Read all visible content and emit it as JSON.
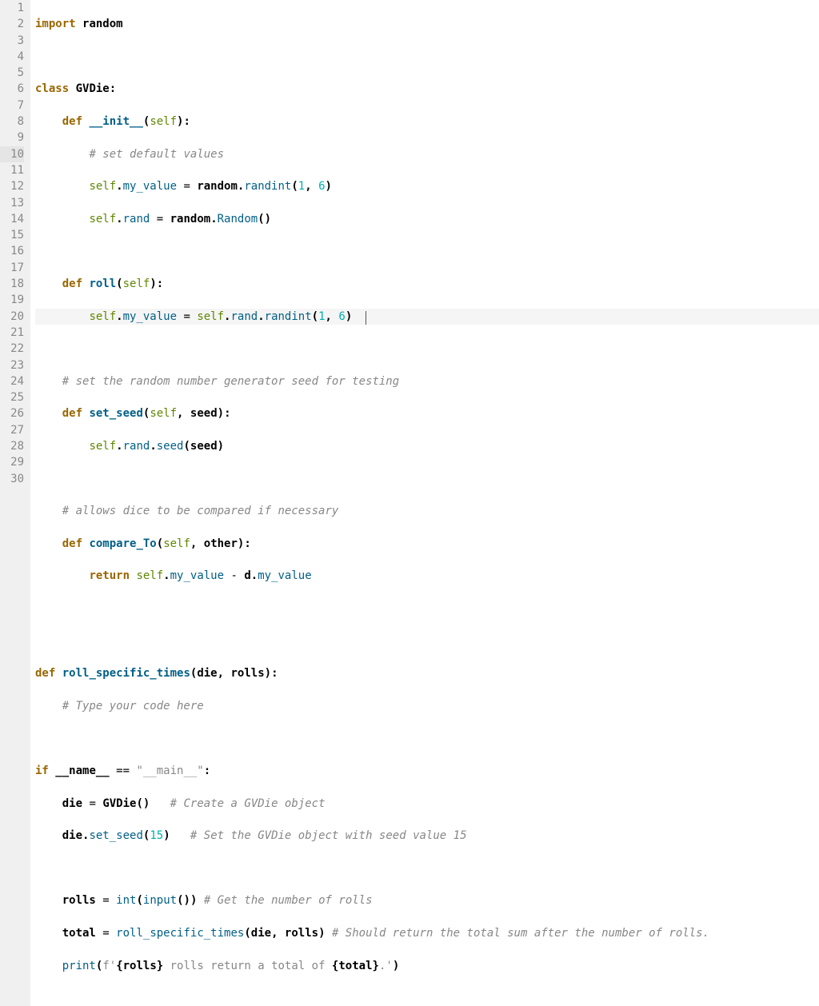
{
  "line_numbers": [
    "1",
    "2",
    "3",
    "4",
    "5",
    "6",
    "7",
    "8",
    "9",
    "10",
    "11",
    "12",
    "13",
    "14",
    "15",
    "16",
    "17",
    "18",
    "19",
    "20",
    "21",
    "22",
    "23",
    "24",
    "25",
    "26",
    "27",
    "28",
    "29",
    "30"
  ],
  "highlighted_line": 10,
  "code": {
    "l1": {
      "kw_import": "import",
      "mod": "random"
    },
    "l3": {
      "kw_class": "class",
      "name": "GVDie",
      "colon": ":"
    },
    "l4": {
      "kw_def": "def",
      "fn": "__init__",
      "lp": "(",
      "self": "self",
      "rp": ")",
      "colon": ":"
    },
    "l5": {
      "comment": "# set default values"
    },
    "l6": {
      "self1": "self",
      "attr1": "my_value",
      "eq": " = ",
      "mod": "random",
      "fn": "randint",
      "lp": "(",
      "n1": "1",
      "comma": ", ",
      "n2": "6",
      "rp": ")"
    },
    "l7": {
      "self1": "self",
      "attr1": "rand",
      "eq": " = ",
      "mod": "random",
      "fn": "Random",
      "lp": "(",
      "rp": ")"
    },
    "l9": {
      "kw_def": "def",
      "fn": "roll",
      "lp": "(",
      "self": "self",
      "rp": ")",
      "colon": ":"
    },
    "l10": {
      "self1": "self",
      "attr1": "my_value",
      "eq": " = ",
      "self2": "self",
      "attr2": "rand",
      "fn": "randint",
      "lp": "(",
      "n1": "1",
      "comma": ", ",
      "n2": "6",
      "rp": ")"
    },
    "l12": {
      "comment": "# set the random number generator seed for testing"
    },
    "l13": {
      "kw_def": "def",
      "fn": "set_seed",
      "lp": "(",
      "self": "self",
      "comma": ", ",
      "arg": "seed",
      "rp": ")",
      "colon": ":"
    },
    "l14": {
      "self1": "self",
      "attr1": "rand",
      "fn": "seed",
      "lp": "(",
      "arg": "seed",
      "rp": ")"
    },
    "l16": {
      "comment": "# allows dice to be compared if necessary"
    },
    "l17": {
      "kw_def": "def",
      "fn": "compare_To",
      "lp": "(",
      "self": "self",
      "comma": ", ",
      "arg": "other",
      "rp": ")",
      "colon": ":"
    },
    "l18": {
      "kw_return": "return",
      "self1": "self",
      "attr1": "my_value",
      "minus": " - ",
      "d": "d",
      "attr2": "my_value"
    },
    "l21": {
      "kw_def": "def",
      "fn": "roll_specific_times",
      "lp": "(",
      "a1": "die",
      "comma": ", ",
      "a2": "rolls",
      "rp": ")",
      "colon": ":"
    },
    "l22": {
      "comment": "# Type your code here"
    },
    "l24": {
      "kw_if": "if",
      "name": "__name__",
      "eq": " == ",
      "str": "\"__main__\"",
      "colon": ":"
    },
    "l25": {
      "var": "die",
      "eq": " = ",
      "cls": "GVDie",
      "lp": "(",
      "rp": ")",
      "comment": "# Create a GVDie object"
    },
    "l26": {
      "var": "die",
      "fn": "set_seed",
      "lp": "(",
      "n": "15",
      "rp": ")",
      "comment": "# Set the GVDie object with seed value 15"
    },
    "l28": {
      "var": "rolls",
      "eq": " = ",
      "fn": "int",
      "lp": "(",
      "fn2": "input",
      "lp2": "(",
      "rp2": ")",
      "rp": ")",
      "comment": "# Get the number of rolls"
    },
    "l29": {
      "var": "total",
      "eq": " = ",
      "fn": "roll_specific_times",
      "lp": "(",
      "a1": "die",
      "comma": ", ",
      "a2": "rolls",
      "rp": ")",
      "comment": "# Should return the total sum after the number of rolls."
    },
    "l30": {
      "fn": "print",
      "lp": "(",
      "fprefix": "f",
      "q1": "'",
      "s1": "{rolls}",
      "t1": " rolls return a total of ",
      "s2": "{total}",
      "t2": ".",
      "q2": "'",
      "rp": ")"
    }
  }
}
